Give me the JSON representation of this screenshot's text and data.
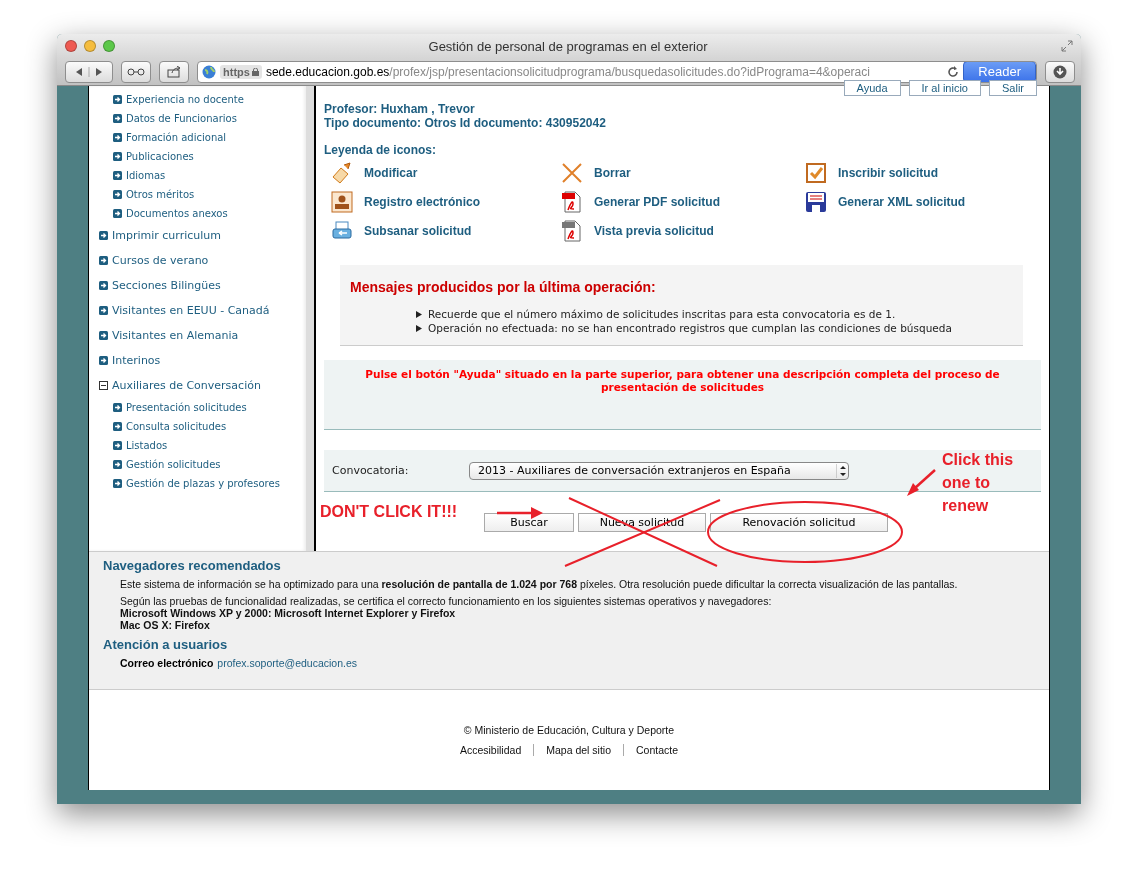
{
  "window": {
    "title": "Gestión de personal de programas en el exterior"
  },
  "address_bar": {
    "scheme": "https",
    "domain": "sede.educacion.gob.es",
    "path": "/profex/jsp/presentacionsolicitudprograma/busquedasolicitudes.do?idPrograma=4&operaci",
    "reader": "Reader"
  },
  "sidebar": {
    "continued_items": [
      "Experiencia no docente",
      "Datos de Funcionarios",
      "Formación adicional",
      "Publicaciones",
      "Idiomas",
      "Otros méritos",
      "Documentos anexos"
    ],
    "items": [
      {
        "label": "Imprimir curriculum",
        "expanded": false
      },
      {
        "label": "Cursos de verano",
        "expanded": false
      },
      {
        "label": "Secciones Bilingües",
        "expanded": false
      },
      {
        "label": "Visitantes en EEUU - Canadá",
        "expanded": false
      },
      {
        "label": "Visitantes en Alemania",
        "expanded": false
      },
      {
        "label": "Interinos",
        "expanded": false
      },
      {
        "label": "Auxiliares de Conversación",
        "expanded": true,
        "children": [
          "Presentación solicitudes",
          "Consulta solicitudes",
          "Listados",
          "Gestión solicitudes",
          "Gestión de plazas y profesores"
        ]
      }
    ]
  },
  "header_buttons": [
    "Ayuda",
    "Ir al inicio",
    "Salir"
  ],
  "profile": [
    "Profesor: Huxham , Trevor",
    "Tipo documento: Otros Id documento: 430952042"
  ],
  "legend": {
    "title": "Leyenda de iconos:",
    "items": [
      {
        "kind": "edit",
        "label": "Modificar"
      },
      {
        "kind": "delete",
        "label": "Borrar"
      },
      {
        "kind": "enroll",
        "label": "Inscribir solicitud"
      },
      {
        "kind": "register",
        "label": "Registro electrónico"
      },
      {
        "kind": "pdf",
        "label": "Generar PDF solicitud"
      },
      {
        "kind": "xml",
        "label": "Generar XML solicitud"
      },
      {
        "kind": "amend",
        "label": "Subsanar solicitud"
      },
      {
        "kind": "preview",
        "label": "Vista previa solicitud"
      }
    ]
  },
  "messages": {
    "title": "Mensajes producidos por la última operación:",
    "items": [
      "Recuerde que el número máximo de solicitudes inscritas para esta convocatoria es de 1.",
      "Operación no efectuada: no se han encontrado registros que cumplan las condiciones de búsqueda"
    ]
  },
  "help_notice": "Pulse el botón \"Ayuda\" situado en la parte superior, para obtener una descripción completa del proceso de presentación de solicitudes",
  "form": {
    "label": "Convocatoria:",
    "value": "2013 - Auxiliares de conversación extranjeros en España"
  },
  "buttons": [
    "Buscar",
    "Nueva solicitud",
    "Renovación solicitud"
  ],
  "annotations": {
    "warning": "DON'T CLICK IT!!!",
    "hint": "Click this one to renew"
  },
  "info": {
    "browsers_title": "Navegadores recomendados",
    "paragraphs": [
      "Este sistema de información se ha optimizado para una **resolución de pantalla de 1.024 por 768** píxeles. Otra resolución puede dificultar la correcta visualización de las pantallas.",
      "Según las pruebas de funcionalidad realizadas, se certifica el correcto funcionamiento en los siguientes sistemas operativos y navegadores:"
    ],
    "platforms": [
      "Microsoft Windows XP y 2000: Microsoft Internet Explorer y Firefox",
      "Mac OS X: Firefox"
    ],
    "support_title": "Atención a usuarios",
    "contact_label": "Correo electrónico",
    "contact_email": "profex.soporte@educacion.es"
  },
  "footer": {
    "copyright": "© Ministerio de Educación, Cultura y Deporte",
    "links": [
      "Accesibilidad",
      "Mapa del sitio",
      "Contacte"
    ]
  }
}
